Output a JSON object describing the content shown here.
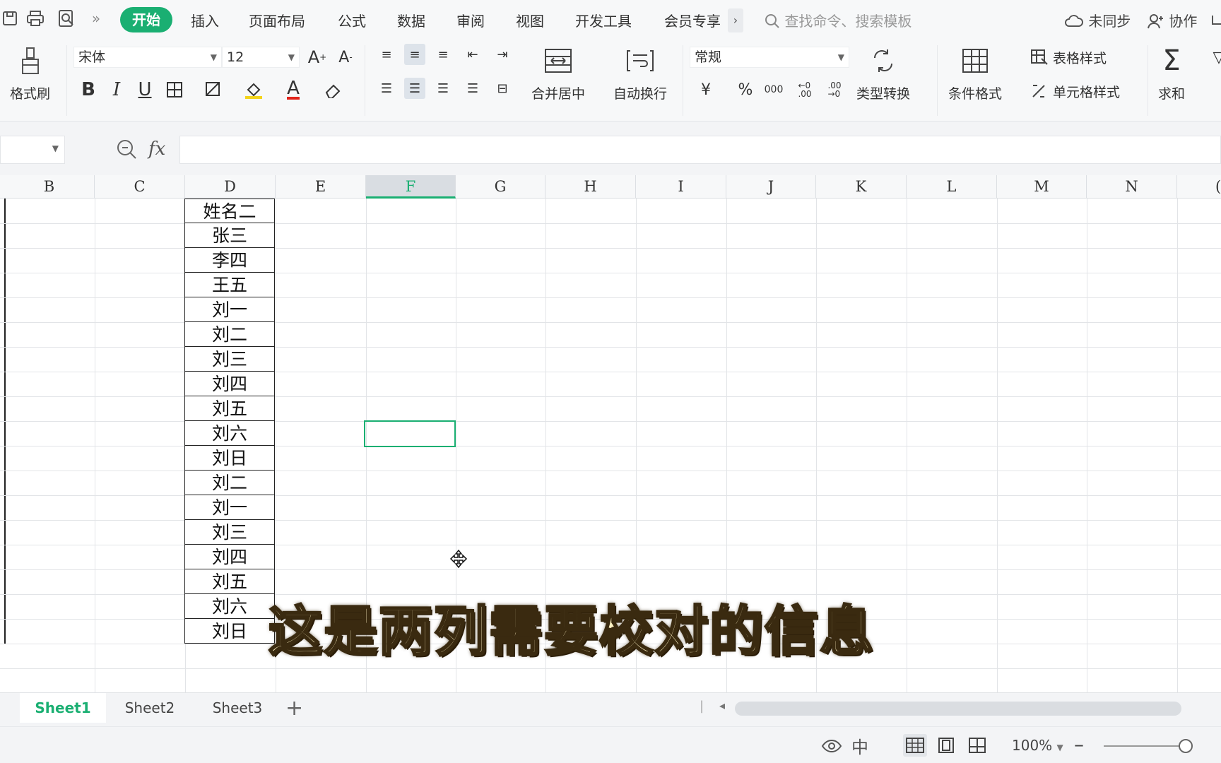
{
  "menu": {
    "tabs": [
      "开始",
      "插入",
      "页面布局",
      "公式",
      "数据",
      "审阅",
      "视图",
      "开发工具",
      "会员专享"
    ],
    "search_placeholder": "查找命令、搜索模板",
    "sync": "未同步",
    "collab": "协作"
  },
  "ribbon": {
    "format_painter": "格式刷",
    "font_name": "宋体",
    "font_size": "12",
    "merge_center": "合并居中",
    "wrap_text": "自动换行",
    "number_format": "常规",
    "type_convert": "类型转换",
    "table_style": "表格样式",
    "cond_format": "条件格式",
    "cell_style": "单元格样式",
    "sum": "求和"
  },
  "formula_bar": {
    "fx": "fx",
    "value": ""
  },
  "columns": [
    "B",
    "C",
    "D",
    "E",
    "F",
    "G",
    "H",
    "I",
    "J",
    "K",
    "L",
    "M",
    "N"
  ],
  "selected_column": "F",
  "column_d_values": [
    "姓名二",
    "张三",
    "李四",
    "王五",
    "刘一",
    "刘二",
    "刘三",
    "刘四",
    "刘五",
    "刘六",
    "刘日",
    "刘二",
    "刘一",
    "刘三",
    "刘四",
    "刘五",
    "刘六",
    "刘日"
  ],
  "subtitle": "这是两列需要校对的信息",
  "sheets": [
    "Sheet1",
    "Sheet2",
    "Sheet3"
  ],
  "active_sheet": "Sheet1",
  "status": {
    "zoom": "100%"
  },
  "colors": {
    "accent": "#1aaf72"
  }
}
